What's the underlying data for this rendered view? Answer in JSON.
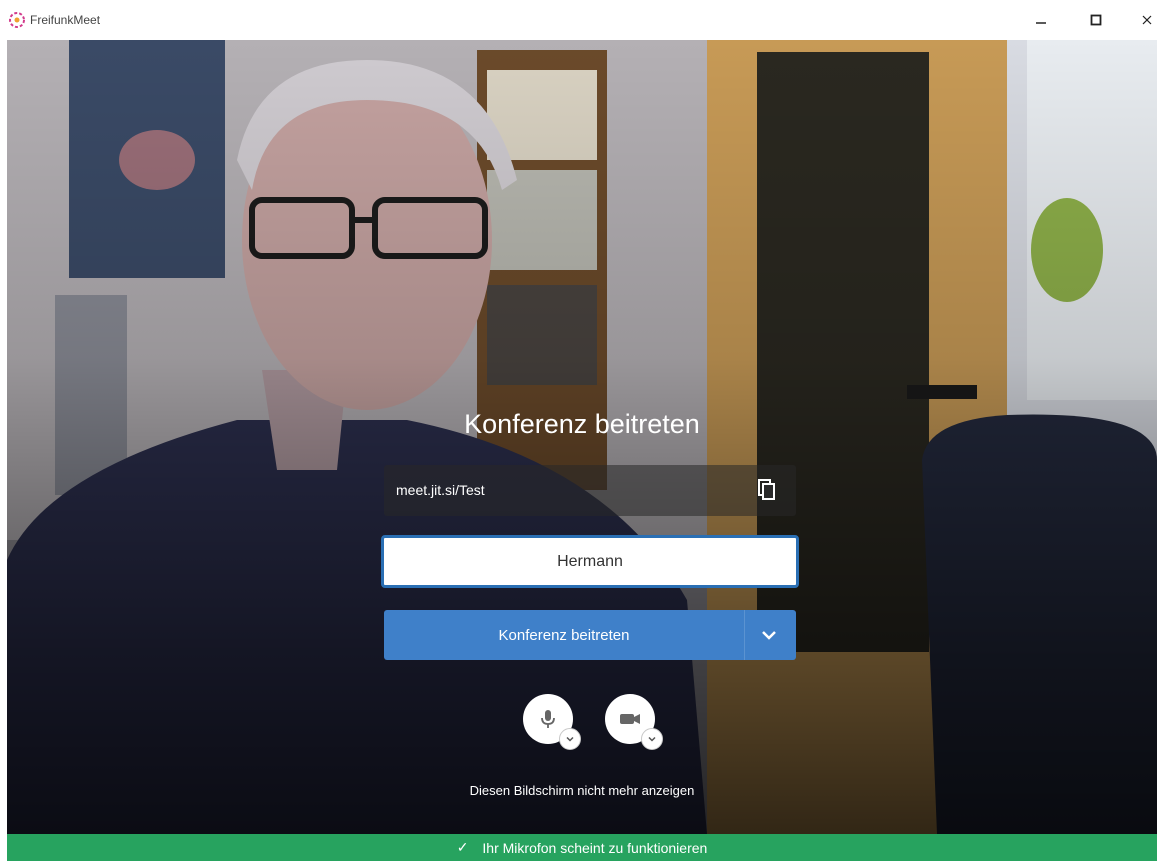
{
  "window": {
    "title": "FreifunkMeet",
    "logo_icon": "freifunk-flower-icon",
    "controls": {
      "minimize": "–",
      "maximize": "☐",
      "close": "✕"
    }
  },
  "prejoin": {
    "title": "Konferenz beitreten",
    "room_url": "meet.jit.si/Test",
    "copy_icon": "copy-icon",
    "name_value": "Hermann",
    "join_label": "Konferenz beitreten",
    "join_dropdown_icon": "chevron-down-icon",
    "mic_icon": "microphone-icon",
    "camera_icon": "video-camera-icon",
    "dont_show_again": "Diesen Bildschirm nicht mehr anzeigen"
  },
  "status": {
    "icon": "✓",
    "text": "Ihr Mikrofon scheint zu funktionieren"
  },
  "colors": {
    "accent": "#3f80c9",
    "input_border": "#2a6fb4",
    "status_bg": "#27a35f"
  }
}
